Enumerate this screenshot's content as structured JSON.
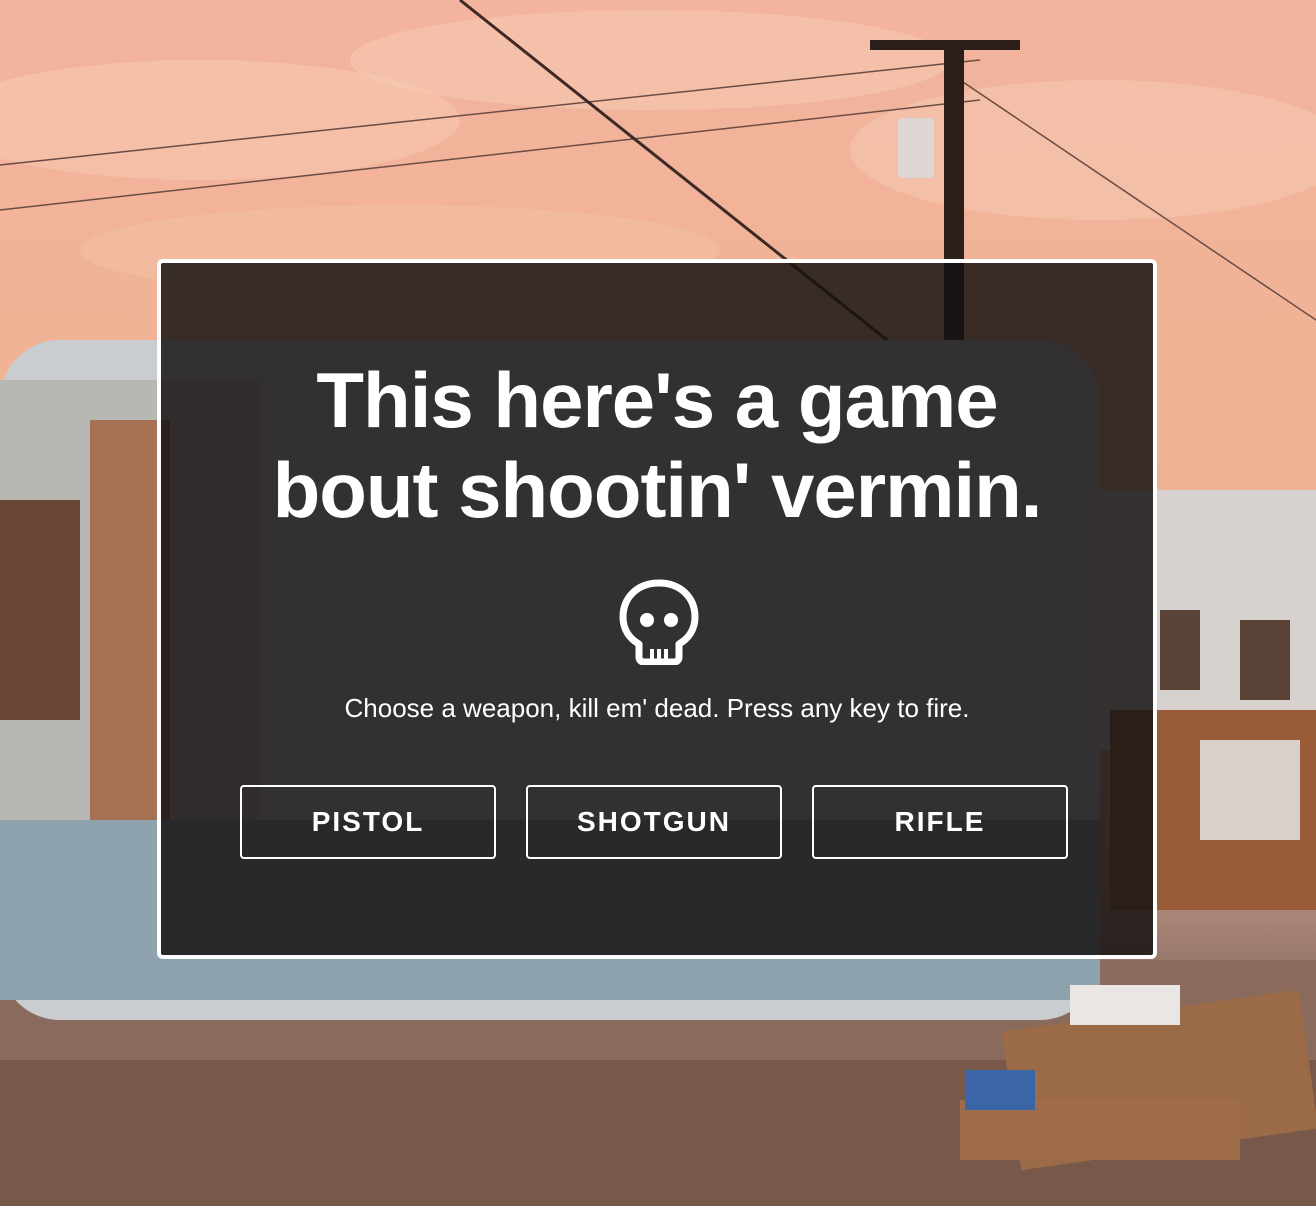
{
  "game": {
    "title_line1": "This here's a game",
    "title_line2": "bout shootin' vermin.",
    "icon": "skull-icon",
    "instructions": "Choose a weapon, kill em' dead. Press any key to fire.",
    "weapons": [
      {
        "label": "PISTOL"
      },
      {
        "label": "SHOTGUN"
      },
      {
        "label": "RIFLE"
      }
    ]
  },
  "colors": {
    "sky": "#f3b39e",
    "overlay": "#161212",
    "text": "#ffffff",
    "border": "#ffffff"
  }
}
